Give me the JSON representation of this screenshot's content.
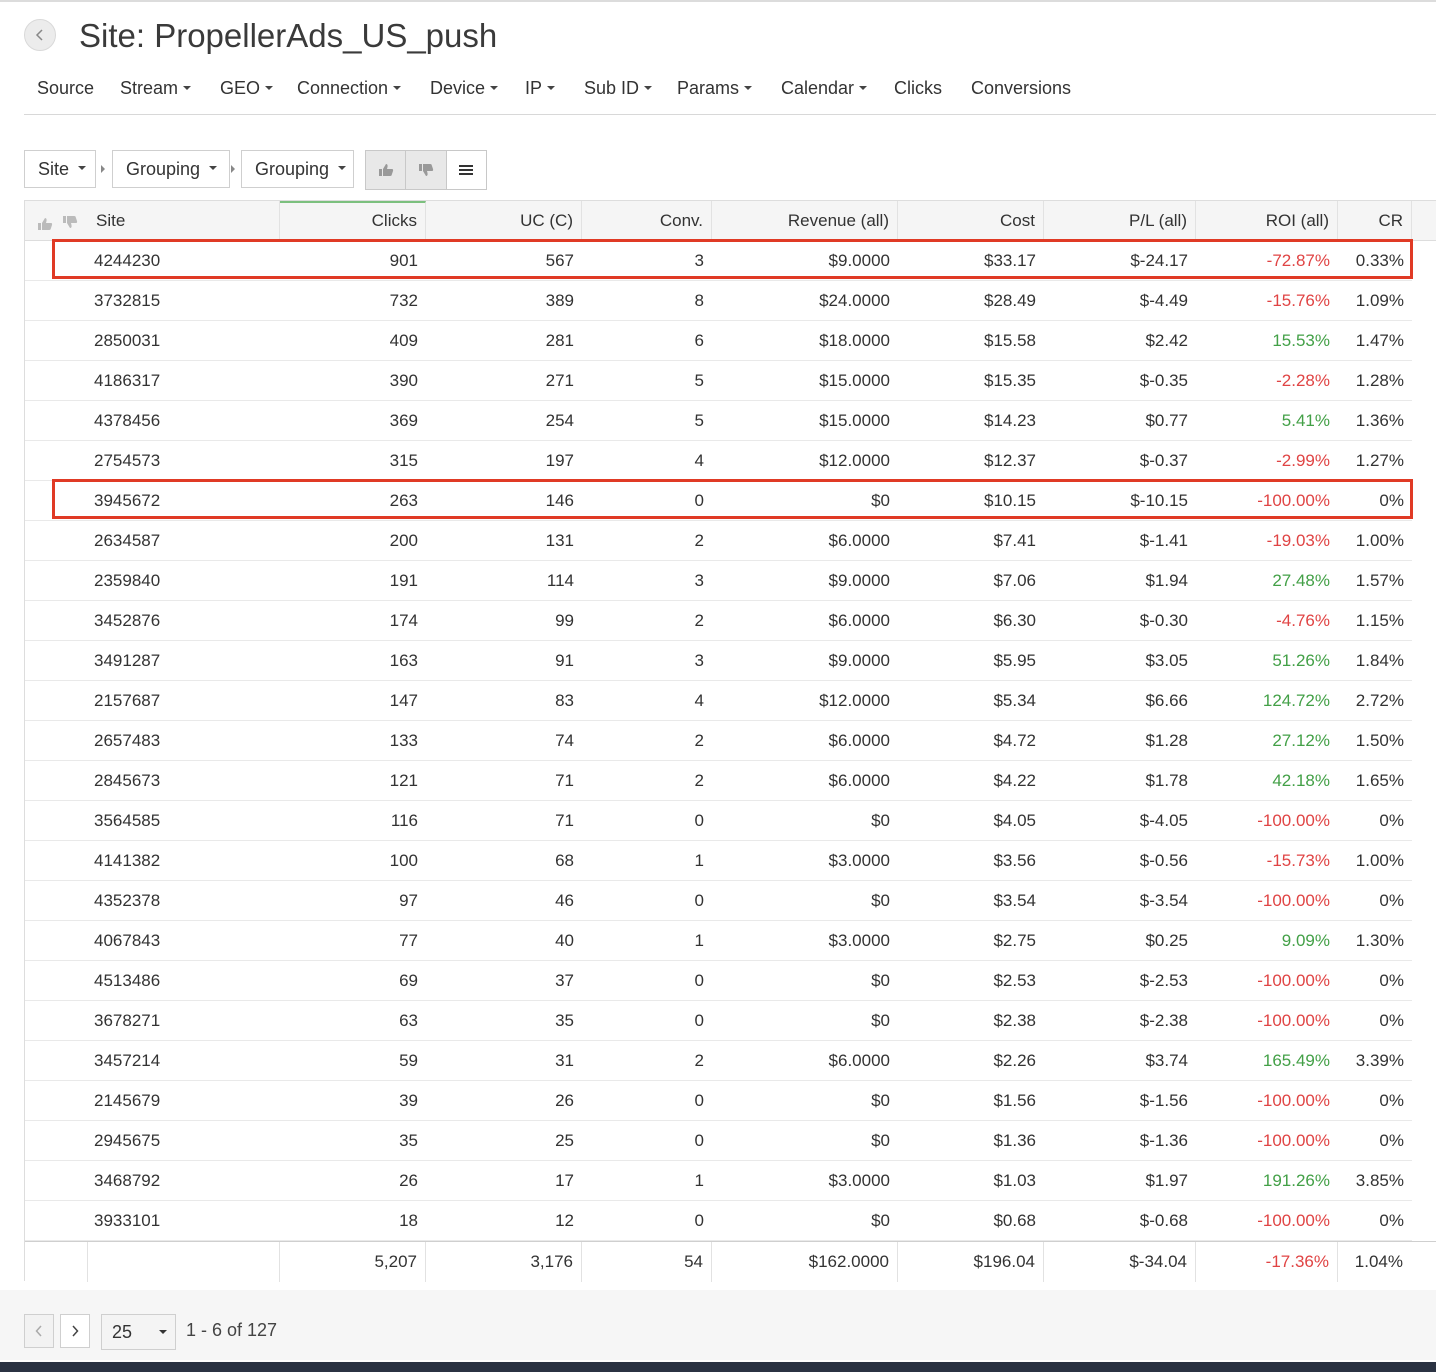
{
  "header": {
    "back_icon": "chevron-left-icon",
    "title": "Site: PropellerAds_US_push"
  },
  "nav": [
    {
      "label": "Source",
      "dropdown": false
    },
    {
      "label": "Stream",
      "dropdown": true
    },
    {
      "label": "GEO",
      "dropdown": true
    },
    {
      "label": "Connection",
      "dropdown": true
    },
    {
      "label": "Device",
      "dropdown": true
    },
    {
      "label": "IP",
      "dropdown": true
    },
    {
      "label": "Sub ID",
      "dropdown": true
    },
    {
      "label": "Params",
      "dropdown": true
    },
    {
      "label": "Calendar",
      "dropdown": true
    },
    {
      "label": "Clicks",
      "dropdown": false
    },
    {
      "label": "Conversions",
      "dropdown": false
    }
  ],
  "toolbar": {
    "group1": "Site",
    "group2": "Grouping",
    "group3": "Grouping",
    "icons": [
      "thumbs-up-icon",
      "thumbs-down-icon",
      "menu-icon"
    ]
  },
  "table": {
    "columns": [
      "Site",
      "Clicks",
      "UC (C)",
      "Conv.",
      "Revenue (all)",
      "Cost",
      "P/L (all)",
      "ROI (all)",
      "CR"
    ],
    "sorted_column": "Clicks",
    "rows": [
      [
        "4244230",
        "901",
        "567",
        "3",
        "$9.0000",
        "$33.17",
        "$-24.17",
        "-72.87%",
        "0.33%"
      ],
      [
        "3732815",
        "732",
        "389",
        "8",
        "$24.0000",
        "$28.49",
        "$-4.49",
        "-15.76%",
        "1.09%"
      ],
      [
        "2850031",
        "409",
        "281",
        "6",
        "$18.0000",
        "$15.58",
        "$2.42",
        "15.53%",
        "1.47%"
      ],
      [
        "4186317",
        "390",
        "271",
        "5",
        "$15.0000",
        "$15.35",
        "$-0.35",
        "-2.28%",
        "1.28%"
      ],
      [
        "4378456",
        "369",
        "254",
        "5",
        "$15.0000",
        "$14.23",
        "$0.77",
        "5.41%",
        "1.36%"
      ],
      [
        "2754573",
        "315",
        "197",
        "4",
        "$12.0000",
        "$12.37",
        "$-0.37",
        "-2.99%",
        "1.27%"
      ],
      [
        "3945672",
        "263",
        "146",
        "0",
        "$0",
        "$10.15",
        "$-10.15",
        "-100.00%",
        "0%"
      ],
      [
        "2634587",
        "200",
        "131",
        "2",
        "$6.0000",
        "$7.41",
        "$-1.41",
        "-19.03%",
        "1.00%"
      ],
      [
        "2359840",
        "191",
        "114",
        "3",
        "$9.0000",
        "$7.06",
        "$1.94",
        "27.48%",
        "1.57%"
      ],
      [
        "3452876",
        "174",
        "99",
        "2",
        "$6.0000",
        "$6.30",
        "$-0.30",
        "-4.76%",
        "1.15%"
      ],
      [
        "3491287",
        "163",
        "91",
        "3",
        "$9.0000",
        "$5.95",
        "$3.05",
        "51.26%",
        "1.84%"
      ],
      [
        "2157687",
        "147",
        "83",
        "4",
        "$12.0000",
        "$5.34",
        "$6.66",
        "124.72%",
        "2.72%"
      ],
      [
        "2657483",
        "133",
        "74",
        "2",
        "$6.0000",
        "$4.72",
        "$1.28",
        "27.12%",
        "1.50%"
      ],
      [
        "2845673",
        "121",
        "71",
        "2",
        "$6.0000",
        "$4.22",
        "$1.78",
        "42.18%",
        "1.65%"
      ],
      [
        "3564585",
        "116",
        "71",
        "0",
        "$0",
        "$4.05",
        "$-4.05",
        "-100.00%",
        "0%"
      ],
      [
        "4141382",
        "100",
        "68",
        "1",
        "$3.0000",
        "$3.56",
        "$-0.56",
        "-15.73%",
        "1.00%"
      ],
      [
        "4352378",
        "97",
        "46",
        "0",
        "$0",
        "$3.54",
        "$-3.54",
        "-100.00%",
        "0%"
      ],
      [
        "4067843",
        "77",
        "40",
        "1",
        "$3.0000",
        "$2.75",
        "$0.25",
        "9.09%",
        "1.30%"
      ],
      [
        "4513486",
        "69",
        "37",
        "0",
        "$0",
        "$2.53",
        "$-2.53",
        "-100.00%",
        "0%"
      ],
      [
        "3678271",
        "63",
        "35",
        "0",
        "$0",
        "$2.38",
        "$-2.38",
        "-100.00%",
        "0%"
      ],
      [
        "3457214",
        "59",
        "31",
        "2",
        "$6.0000",
        "$2.26",
        "$3.74",
        "165.49%",
        "3.39%"
      ],
      [
        "2145679",
        "39",
        "26",
        "0",
        "$0",
        "$1.56",
        "$-1.56",
        "-100.00%",
        "0%"
      ],
      [
        "2945675",
        "35",
        "25",
        "0",
        "$0",
        "$1.36",
        "$-1.36",
        "-100.00%",
        "0%"
      ],
      [
        "3468792",
        "26",
        "17",
        "1",
        "$3.0000",
        "$1.03",
        "$1.97",
        "191.26%",
        "3.85%"
      ],
      [
        "3933101",
        "18",
        "12",
        "0",
        "$0",
        "$0.68",
        "$-0.68",
        "-100.00%",
        "0%"
      ]
    ],
    "highlighted_rows": [
      "4244230",
      "3945672"
    ],
    "totals": [
      "5,207",
      "3,176",
      "54",
      "$162.0000",
      "$196.04",
      "$-34.04",
      "-17.36%",
      "1.04%"
    ]
  },
  "pagination": {
    "page_size": "25",
    "range": "1 - 6 of 127"
  },
  "colors": {
    "positive": "#43a047",
    "negative": "#e04444",
    "highlight_border": "#e03a25",
    "sort_accent": "#7cc07e"
  }
}
